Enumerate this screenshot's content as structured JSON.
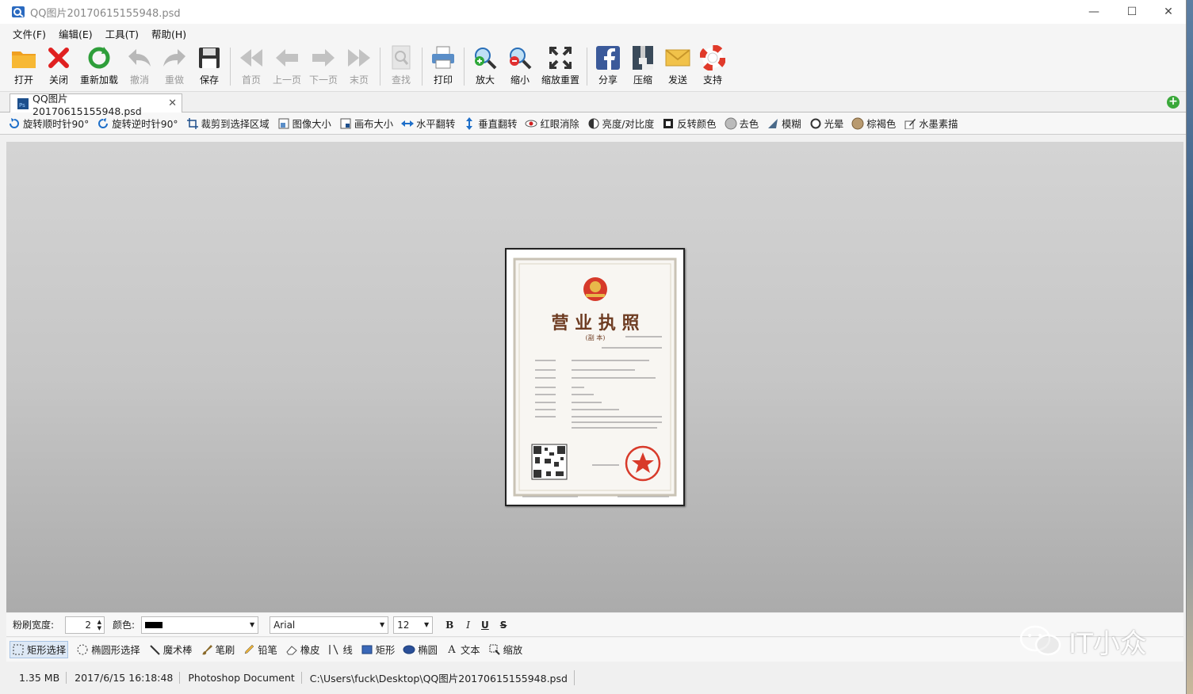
{
  "window": {
    "title": "QQ图片20170615155948.psd",
    "minimize": "—",
    "maximize": "☐",
    "close": "✕"
  },
  "menu": [
    "文件(F)",
    "编辑(E)",
    "工具(T)",
    "帮助(H)"
  ],
  "toolbar": {
    "open": "打开",
    "close": "关闭",
    "reload": "重新加载",
    "undo": "撤消",
    "redo": "重做",
    "save": "保存",
    "first": "首页",
    "prev": "上一页",
    "next": "下一页",
    "last": "末页",
    "find": "查找",
    "print": "打印",
    "zoomin": "放大",
    "zoomout": "缩小",
    "zoomreset": "缩放重置",
    "share": "分享",
    "compress": "压缩",
    "send": "发送",
    "support": "支持"
  },
  "tab": {
    "label": "QQ图片20170615155948.psd",
    "close": "✕",
    "add": "+"
  },
  "imagebar": [
    "旋转顺时针90°",
    "旋转逆时针90°",
    "裁剪到选择区域",
    "图像大小",
    "画布大小",
    "水平翻转",
    "垂直翻转",
    "红眼消除",
    "亮度/对比度",
    "反转颜色",
    "去色",
    "模糊",
    "光晕",
    "棕褐色",
    "水墨素描"
  ],
  "brushbar": {
    "width_label": "粉刷宽度:",
    "width_value": "2",
    "color_label": "颜色:",
    "font": "Arial",
    "size": "12",
    "bold": "B",
    "italic": "I",
    "underline": "U",
    "strike": "S"
  },
  "drawbar": [
    "矩形选择",
    "椭圆形选择",
    "魔术棒",
    "笔刷",
    "铅笔",
    "橡皮",
    "线",
    "矩形",
    "椭圆",
    "文本",
    "缩放"
  ],
  "status": {
    "size": "1.35 MB",
    "date": "2017/6/15 16:18:48",
    "type": "Photoshop Document",
    "path": "C:\\Users\\fuck\\Desktop\\QQ图片20170615155948.psd"
  },
  "document": {
    "heading": "营 业 执 照",
    "subheading": "(副 本)"
  },
  "watermark": "IT小众",
  "colors": {
    "accent": "#1e6fc9",
    "brush_color": "#000000"
  }
}
